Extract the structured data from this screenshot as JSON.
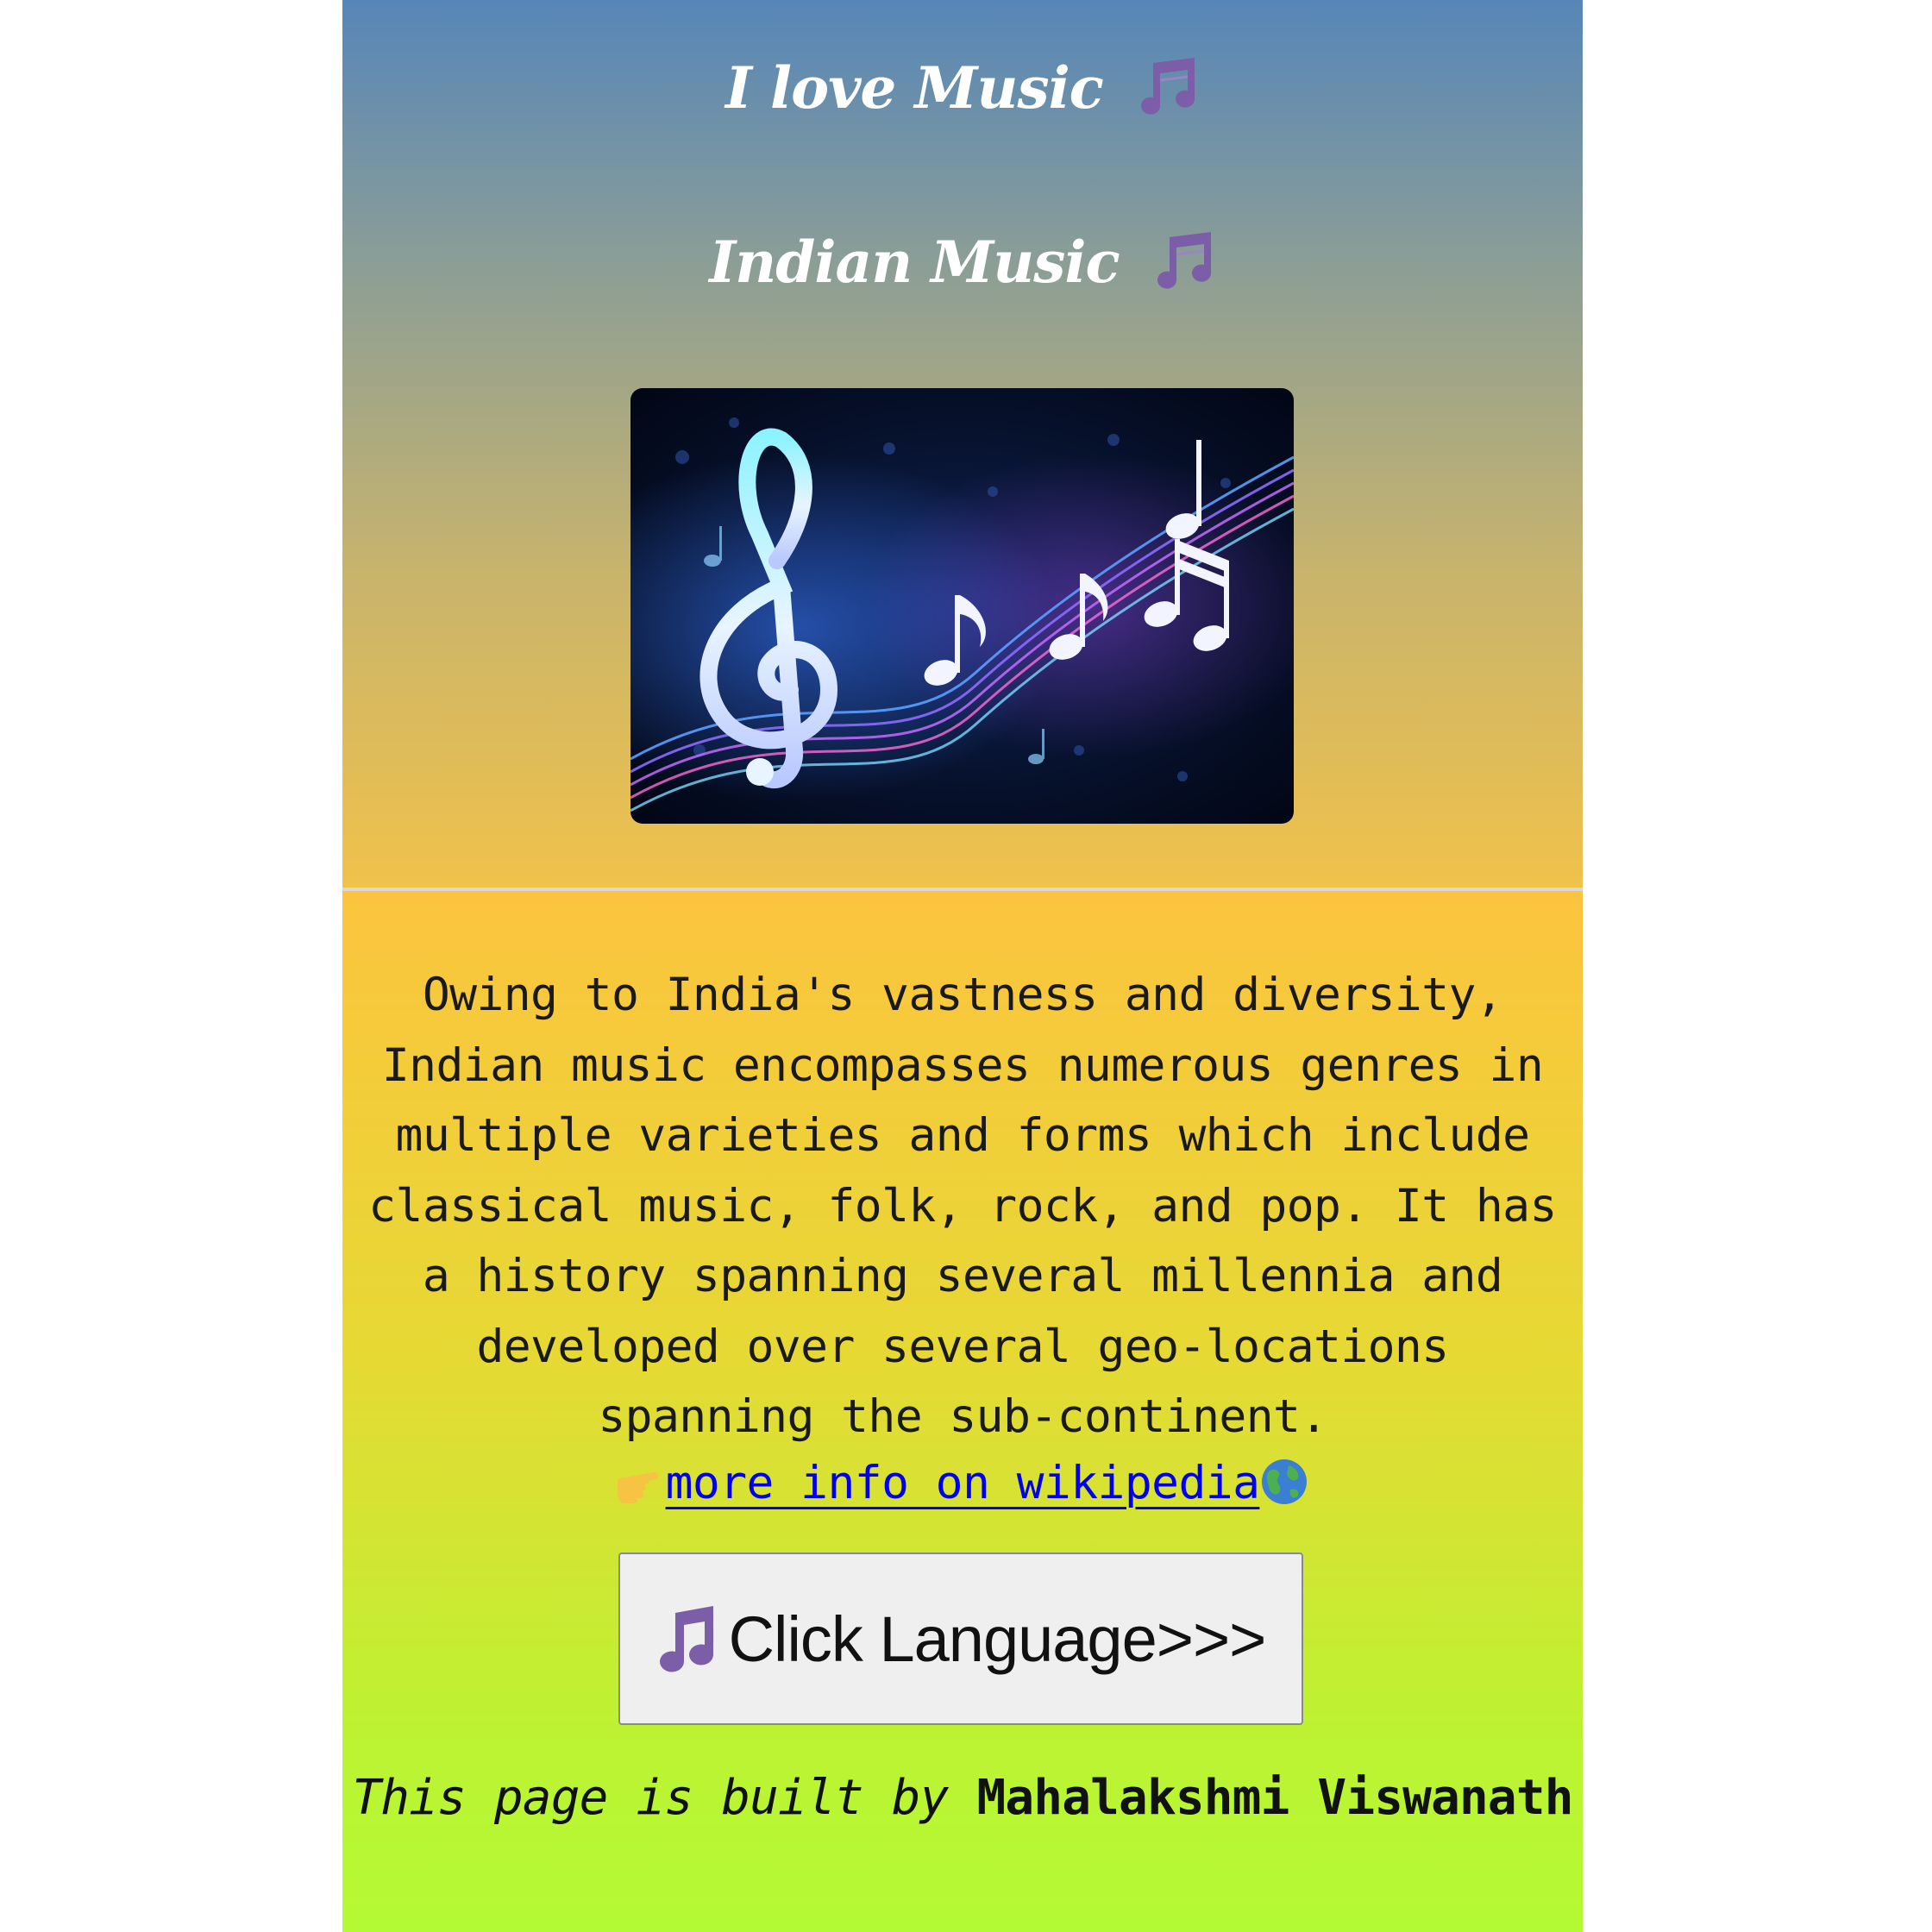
{
  "header": {
    "title": "I love Music",
    "title_icon": "musical-notes-icon"
  },
  "section": {
    "heading": "Indian Music",
    "heading_icon": "musical-notes-icon",
    "image": {
      "subject": "treble-clef-and-music-notes-artwork",
      "colors": {
        "background": "#07122e",
        "glow": "#7fd8ff",
        "accent": "#c86bff"
      }
    }
  },
  "content": {
    "description": "Owing to India's vastness and diversity, Indian music encompasses numerous genres in multiple varieties and forms which include classical music, folk, rock, and pop. It has a history spanning several millennia and developed over several geo-locations spanning the sub-continent.",
    "wiki_link_label": "more info on wikipedia",
    "wiki_link_prefix_icon": "pointing-hand-icon",
    "wiki_link_suffix_icon": "globe-icon"
  },
  "button": {
    "label": "Click Language>>>",
    "icon": "musical-note-icon"
  },
  "footer": {
    "lead": "This page is built by ",
    "author": "Mahalakshmi Viswanath"
  },
  "colors": {
    "top_gradient_start": "#5686b8",
    "top_gradient_end": "#f0c24a",
    "bottom_gradient_start": "#fcc43e",
    "bottom_gradient_end": "#b4fa34",
    "note_icon": "#7b5ea7",
    "link": "#0000ee"
  }
}
